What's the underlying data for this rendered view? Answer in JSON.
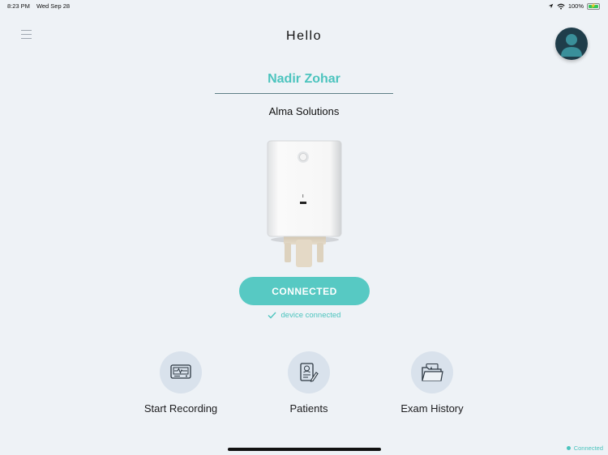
{
  "status_bar": {
    "time": "8:23 PM",
    "date": "Wed Sep 28",
    "battery": "100%",
    "icons": [
      "location-icon",
      "wifi-icon",
      "battery-charging-icon"
    ]
  },
  "header": {
    "title": "Hello",
    "menu_icon": "hamburger-menu-icon",
    "avatar_icon": "user-avatar-icon"
  },
  "user": {
    "name": "Nadir Zohar",
    "organization": "Alma Solutions"
  },
  "device": {
    "button_label": "CONNECTED",
    "status_text": "device connected",
    "status_icon": "checkmark-icon"
  },
  "actions": [
    {
      "label": "Start Recording",
      "icon": "ecg-monitor-icon"
    },
    {
      "label": "Patients",
      "icon": "patient-record-icon"
    },
    {
      "label": "Exam History",
      "icon": "folder-chart-icon"
    }
  ],
  "footer": {
    "connection_label": "Connected"
  },
  "colors": {
    "accent": "#57c9c3",
    "accent_text": "#4cc4be",
    "background": "#eef2f6",
    "action_circle": "#d9e2ec",
    "avatar_bg": "#1f3d4a"
  }
}
